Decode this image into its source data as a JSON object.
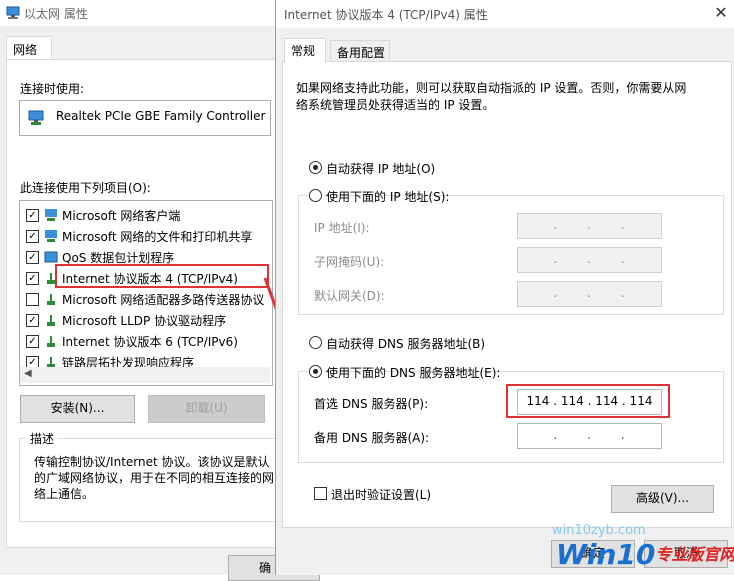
{
  "ethernet_window": {
    "title": "以太网 属性",
    "tab": "网络",
    "connect_using_label": "连接时使用:",
    "adapter_name": "Realtek PCIe GBE Family Controller",
    "components_label": "此连接使用下列项目(O):",
    "components": [
      {
        "label": "Microsoft 网络客户端",
        "checked": true,
        "icon": "network-client-icon"
      },
      {
        "label": "Microsoft 网络的文件和打印机共享",
        "checked": true,
        "icon": "file-share-icon"
      },
      {
        "label": "QoS 数据包计划程序",
        "checked": true,
        "icon": "qos-icon"
      },
      {
        "label": "Internet 协议版本 4 (TCP/IPv4)",
        "checked": true,
        "icon": "protocol-icon"
      },
      {
        "label": "Microsoft 网络适配器多路传送器协议",
        "checked": false,
        "icon": "protocol-icon"
      },
      {
        "label": "Microsoft LLDP 协议驱动程序",
        "checked": true,
        "icon": "protocol-icon"
      },
      {
        "label": "Internet 协议版本 6 (TCP/IPv6)",
        "checked": true,
        "icon": "protocol-icon"
      },
      {
        "label": "链路层拓扑发现响应程序",
        "checked": true,
        "icon": "protocol-icon"
      }
    ],
    "install_button": "安装(N)...",
    "uninstall_button": "卸载(U)",
    "description_legend": "描述",
    "description_text": "传输控制协议/Internet 协议。该协议是默认的广域网络协议，用于在不同的相互连接的网络上通信。",
    "ok_button_partial": "确"
  },
  "ipv4_window": {
    "title": "Internet 协议版本 4 (TCP/IPv4) 属性",
    "close_glyph": "✕",
    "tabs": [
      "常规",
      "备用配置"
    ],
    "intro_text": "如果网络支持此功能，则可以获取自动指派的 IP 设置。否则，你需要从网络系统管理员处获得适当的 IP 设置。",
    "auto_ip_label": "自动获得 IP 地址(O)",
    "manual_ip_label": "使用下面的 IP 地址(S):",
    "ip_address_label": "IP 地址(I):",
    "subnet_mask_label": "子网掩码(U):",
    "gateway_label": "默认网关(D):",
    "empty_ip": ".      .      .",
    "auto_dns_label": "自动获得 DNS 服务器地址(B)",
    "manual_dns_label": "使用下面的 DNS 服务器地址(E):",
    "preferred_dns_label": "首选 DNS 服务器(P):",
    "preferred_dns_value": "114 . 114 . 114 . 114",
    "alternate_dns_label": "备用 DNS 服务器(A):",
    "alternate_dns_value": ".      .      .",
    "validate_label": "退出时验证设置(L)",
    "advanced_button": "高级(V)...",
    "ok_button": "确定",
    "cancel_button": "取消"
  },
  "watermark": {
    "site": "win10zyb.com",
    "logo_main": "Win10",
    "logo_sub": "专业版官网"
  },
  "colors": {
    "highlight": "#e03232",
    "logo_blue": "#1a6fd0",
    "logo_red": "#e02020"
  }
}
